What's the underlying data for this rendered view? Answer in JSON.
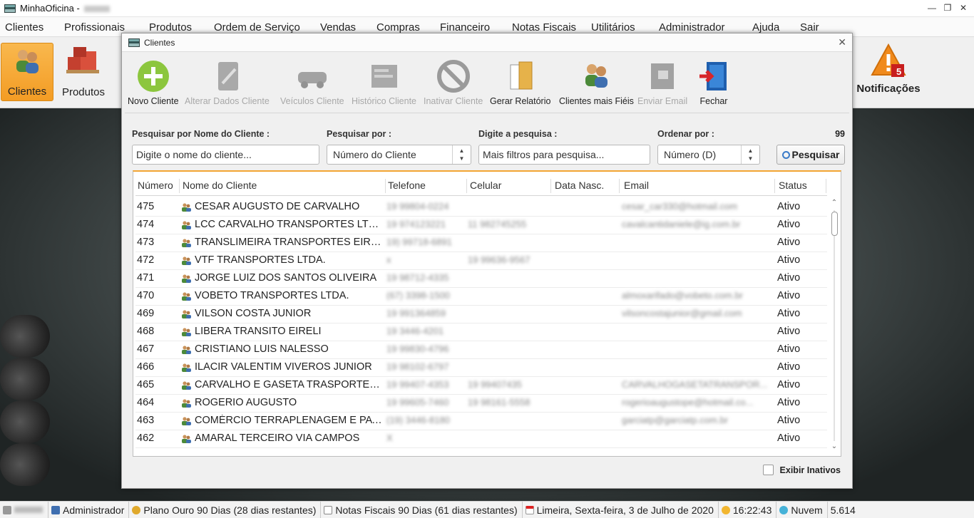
{
  "window": {
    "title": "MinhaOficina -"
  },
  "menu": [
    "Clientes",
    "Profissionais",
    "Produtos",
    "Ordem de Serviço",
    "Vendas",
    "Compras",
    "Financeiro",
    "Notas Fiscais",
    "Utilitários",
    "Administrador",
    "Ajuda",
    "Sair"
  ],
  "main_toolbar": {
    "clientes": "Clientes",
    "produtos": "Produtos",
    "notificacoes": "Notificações",
    "notif_count": "5"
  },
  "dialog": {
    "title": "Clientes",
    "toolbar": {
      "novo": "Novo Cliente",
      "alterar": "Alterar Dados Cliente",
      "veiculos": "Veículos Cliente",
      "historico": "Histórico Cliente",
      "inativar": "Inativar Cliente",
      "relatorio": "Gerar Relatório",
      "fieis": "Clientes mais Fiéis",
      "email": "Enviar Email",
      "fechar": "Fechar"
    },
    "filters": {
      "nome_label": "Pesquisar por Nome do Cliente :",
      "nome_placeholder": "Digite o nome do cliente...",
      "por_label": "Pesquisar por :",
      "por_value": "Número do Cliente",
      "digite_label": "Digite a pesquisa :",
      "digite_placeholder": "Mais filtros para pesquisa...",
      "ordenar_label": "Ordenar por :",
      "ordenar_value": "Número (D)",
      "count": "99",
      "search_button": "Pesquisar"
    },
    "table": {
      "headers": {
        "numero": "Número",
        "nome": "Nome do Cliente",
        "telefone": "Telefone",
        "celular": "Celular",
        "nasc": "Data Nasc.",
        "email": "Email",
        "status": "Status"
      },
      "rows": [
        {
          "numero": "475",
          "nome": "CESAR AUGUSTO DE CARVALHO",
          "telefone": "19 99804-0224",
          "celular": "",
          "email": "cesar_car330@hotmail.com",
          "status": "Ativo"
        },
        {
          "numero": "474",
          "nome": "LCC CARVALHO TRANSPORTES LTDA ...",
          "telefone": "19 974123221",
          "celular": "11 982745255",
          "email": "cavalcantidaniele@ig.com.br",
          "status": "Ativo"
        },
        {
          "numero": "473",
          "nome": "TRANSLIMEIRA TRANSPORTES EIRELI",
          "telefone": "19) 99718-6891",
          "celular": "",
          "email": "",
          "status": "Ativo"
        },
        {
          "numero": "472",
          "nome": "VTF TRANSPORTES LTDA.",
          "telefone": "x",
          "celular": "19 99636-9567",
          "email": "",
          "status": "Ativo"
        },
        {
          "numero": "471",
          "nome": "JORGE LUIZ DOS SANTOS OLIVEIRA",
          "telefone": "19 98712-4335",
          "celular": "",
          "email": "",
          "status": "Ativo"
        },
        {
          "numero": "470",
          "nome": "VOBETO TRANSPORTES LTDA.",
          "telefone": "(67) 3398-1500",
          "celular": "",
          "email": "almoxarifado@vobeto.com.br",
          "status": "Ativo"
        },
        {
          "numero": "469",
          "nome": "VILSON COSTA JUNIOR",
          "telefone": "19 991364859",
          "celular": "",
          "email": "vilsoncostajunior@gmail.com",
          "status": "Ativo"
        },
        {
          "numero": "468",
          "nome": "LIBERA TRANSITO EIRELI",
          "telefone": "19 3446-4201",
          "celular": "",
          "email": "",
          "status": "Ativo"
        },
        {
          "numero": "467",
          "nome": "CRISTIANO LUIS NALESSO",
          "telefone": "19 99830-4796",
          "celular": "",
          "email": "",
          "status": "Ativo"
        },
        {
          "numero": "466",
          "nome": "ILACIR VALENTIM VIVEROS JUNIOR",
          "telefone": "19 98102-6797",
          "celular": "",
          "email": "",
          "status": "Ativo"
        },
        {
          "numero": "465",
          "nome": "CARVALHO E GASETA TRASPORTES LT...",
          "telefone": "19 99407-4353",
          "celular": "19 99407435",
          "email": "CARVALHOGASETATRANSPOR...",
          "status": "Ativo"
        },
        {
          "numero": "464",
          "nome": "ROGERIO AUGUSTO",
          "telefone": "19 99605-7460",
          "celular": "19 98161-5558",
          "email": "rogerioaugustope@hotmail.co...",
          "status": "Ativo"
        },
        {
          "numero": "463",
          "nome": "COMÉRCIO TERRAPLENAGEM E PAVI...",
          "telefone": "(19) 3446-8180",
          "celular": "",
          "email": "garciatp@garciatp.com.br",
          "status": "Ativo"
        },
        {
          "numero": "462",
          "nome": "AMARAL TERCEIRO VIA CAMPOS",
          "telefone": "X",
          "celular": "",
          "email": "",
          "status": "Ativo"
        }
      ]
    },
    "show_inactive": "Exibir Inativos"
  },
  "statusbar": {
    "user": "Administrador",
    "plano": "Plano Ouro 90 Dias (28 dias restantes)",
    "notas": "Notas Fiscais 90 Dias (61 dias restantes)",
    "local_data": "Limeira, Sexta-feira, 3 de Julho de 2020",
    "hora": "16:22:43",
    "nuvem": "Nuvem",
    "versao": "5.614"
  }
}
